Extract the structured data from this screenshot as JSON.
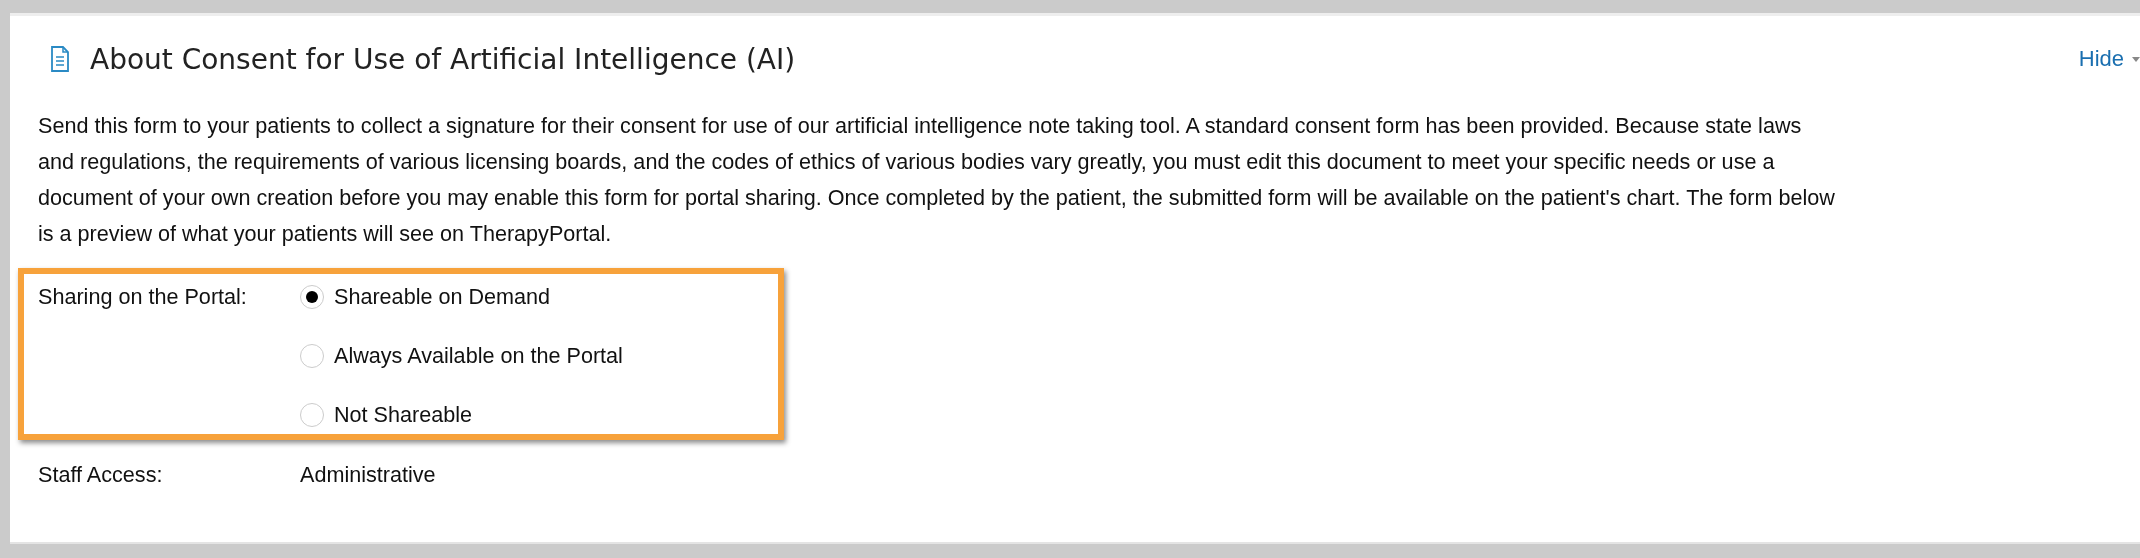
{
  "section": {
    "title": "About Consent for Use of Artificial Intelligence (AI)",
    "toggle": "Hide"
  },
  "description": "Send this form to your patients to collect a signature for their consent for use of our artificial intelligence note taking tool. A standard consent form has been provided. Because state laws\nand regulations, the requirements of various licensing boards, and the codes of ethics of various bodies vary greatly, you must edit this document to meet your specific needs or use a\ndocument of your own creation before you may enable this form for portal sharing. Once completed by the patient, the submitted form will be available on the patient's chart. The form below\nis a preview of what your patients will see on TherapyPortal.",
  "sharing": {
    "label": "Sharing on the Portal:",
    "options": [
      {
        "label": "Shareable on Demand",
        "selected": true
      },
      {
        "label": "Always Available on the Portal",
        "selected": false
      },
      {
        "label": "Not Shareable",
        "selected": false
      }
    ]
  },
  "staff_access": {
    "label": "Staff Access:",
    "value": "Administrative"
  }
}
